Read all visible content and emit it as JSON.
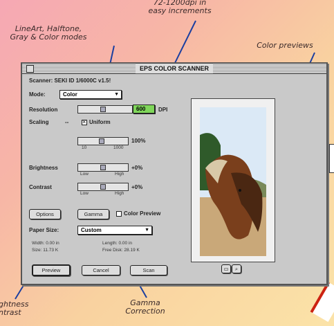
{
  "annotations": {
    "modes": "LineArt, Halftone,\nGray & Color modes",
    "dpi": "72-1200dpi in\neasy increments",
    "previews": "Color previews",
    "brightness": "ghtness\nntrast",
    "gamma": "Gamma\nCorrection"
  },
  "window": {
    "title": "EPS COLOR SCANNER",
    "scanner_label": "Scanner: SEKI ID 1/6000C v1.5!",
    "mode_label": "Mode:",
    "mode_value": "Color",
    "resolution_label": "Resolution",
    "resolution_value": "600",
    "resolution_unit": "DPI",
    "scaling_label": "Scaling",
    "scaling_dash": "--",
    "uniform_label": "Uniform",
    "scale_value": "100%",
    "scale_min": "10",
    "scale_max": "1000",
    "brightness_label": "Brightness",
    "brightness_value": "+0%",
    "brightness_min": "Low",
    "brightness_max": "High",
    "contrast_label": "Contrast",
    "contrast_value": "+0%",
    "contrast_min": "Low",
    "contrast_max": "High",
    "options_label": "Options",
    "gamma_label": "Gamma",
    "color_preview_label": "Color Preview",
    "paper_size_label": "Paper Size:",
    "paper_size_value": "Custom",
    "width_text": "Width: 0.00 in",
    "height_text": "Length: 0.00 in",
    "size_text": "Size: 11.73 K",
    "free_text": "Free Disk: 28.19 K",
    "preview_btn": "Preview",
    "cancel_btn": "Cancel",
    "scan_btn": "Scan"
  },
  "colors": {
    "highlight": "#7fd65a",
    "accent_line": "#1b3fa0"
  }
}
